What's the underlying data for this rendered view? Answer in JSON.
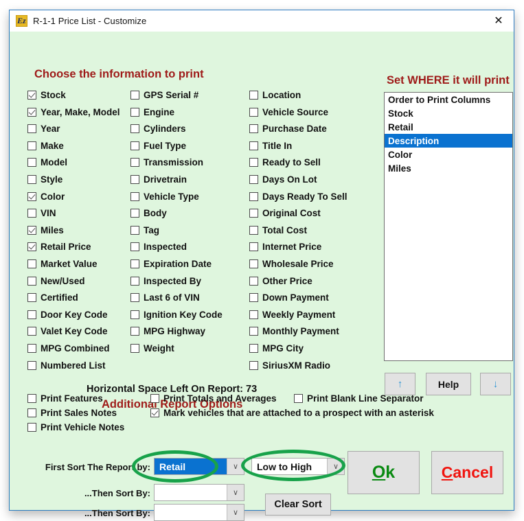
{
  "window": {
    "title": "R-1-1 Price List - Customize",
    "app_icon": "ez-logo-icon",
    "close_label": "✕",
    "background": "#dff6de",
    "border_color": "#2a7ac0"
  },
  "headings": {
    "choose": "Choose the information to print",
    "set_where": "Set WHERE it will print",
    "horizontal_space": "Horizontal Space Left On Report: 73",
    "additional_options": "Additional Report Options"
  },
  "columns": {
    "col1": [
      {
        "label": "Stock",
        "checked": true
      },
      {
        "label": "Year, Make, Model",
        "checked": true
      },
      {
        "label": "Year",
        "checked": false
      },
      {
        "label": "Make",
        "checked": false
      },
      {
        "label": "Model",
        "checked": false
      },
      {
        "label": "Style",
        "checked": false
      },
      {
        "label": "Color",
        "checked": true
      },
      {
        "label": "VIN",
        "checked": false
      },
      {
        "label": "Miles",
        "checked": true
      },
      {
        "label": "Retail Price",
        "checked": true
      },
      {
        "label": "Market Value",
        "checked": false
      },
      {
        "label": "New/Used",
        "checked": false
      },
      {
        "label": "Certified",
        "checked": false
      },
      {
        "label": "Door Key Code",
        "checked": false
      },
      {
        "label": "Valet Key Code",
        "checked": false
      },
      {
        "label": "MPG Combined",
        "checked": false
      },
      {
        "label": "Numbered List",
        "checked": false
      }
    ],
    "col2": [
      {
        "label": "GPS Serial #",
        "checked": false
      },
      {
        "label": "Engine",
        "checked": false
      },
      {
        "label": "Cylinders",
        "checked": false
      },
      {
        "label": "Fuel Type",
        "checked": false
      },
      {
        "label": "Transmission",
        "checked": false
      },
      {
        "label": "Drivetrain",
        "checked": false
      },
      {
        "label": "Vehicle Type",
        "checked": false
      },
      {
        "label": "Body",
        "checked": false
      },
      {
        "label": "Tag",
        "checked": false
      },
      {
        "label": "Inspected",
        "checked": false
      },
      {
        "label": "Expiration Date",
        "checked": false
      },
      {
        "label": "Inspected By",
        "checked": false
      },
      {
        "label": "Last 6 of VIN",
        "checked": false
      },
      {
        "label": "Ignition Key Code",
        "checked": false
      },
      {
        "label": "MPG Highway",
        "checked": false
      },
      {
        "label": "Weight",
        "checked": false
      }
    ],
    "col3": [
      {
        "label": "Location",
        "checked": false
      },
      {
        "label": "Vehicle Source",
        "checked": false
      },
      {
        "label": "Purchase Date",
        "checked": false
      },
      {
        "label": "Title In",
        "checked": false
      },
      {
        "label": "Ready to Sell",
        "checked": false
      },
      {
        "label": "Days On Lot",
        "checked": false
      },
      {
        "label": "Days Ready To Sell",
        "checked": false
      },
      {
        "label": "Original Cost",
        "checked": false
      },
      {
        "label": "Total Cost",
        "checked": false
      },
      {
        "label": "Internet Price",
        "checked": false
      },
      {
        "label": "Wholesale Price",
        "checked": false
      },
      {
        "label": "Other Price",
        "checked": false
      },
      {
        "label": "Down Payment",
        "checked": false
      },
      {
        "label": "Weekly Payment",
        "checked": false
      },
      {
        "label": "Monthly Payment",
        "checked": false
      },
      {
        "label": "MPG City",
        "checked": false
      },
      {
        "label": "SiriusXM Radio",
        "checked": false
      }
    ]
  },
  "order_list": {
    "items": [
      {
        "label": "Order to Print Columns",
        "selected": false
      },
      {
        "label": "Stock",
        "selected": false
      },
      {
        "label": "Retail",
        "selected": false
      },
      {
        "label": "Description",
        "selected": true
      },
      {
        "label": "Color",
        "selected": false
      },
      {
        "label": "Miles",
        "selected": false
      }
    ],
    "selection_color": "#0a72d0"
  },
  "side_buttons": {
    "move_up": "↑",
    "help": "Help",
    "move_down": "↓",
    "arrow_color": "#2e95d3"
  },
  "additional_options": [
    {
      "label": "Print Features",
      "checked": false
    },
    {
      "label": "Print Sales Notes",
      "checked": false
    },
    {
      "label": "Print Vehicle Notes",
      "checked": false
    },
    {
      "label": "Print Totals and Averages",
      "checked": false
    },
    {
      "label": "Mark vehicles that are attached to a prospect with an asterisk",
      "checked": true
    },
    {
      "label": "Print Blank Line Separator",
      "checked": false
    }
  ],
  "sorting": {
    "first_label": "First Sort The Report by:",
    "first_value": "Retail",
    "direction_value": "Low to High",
    "then_label_1": "...Then Sort By:",
    "then_value_1": "",
    "then_label_2": "...Then Sort By:",
    "then_value_2": "",
    "clear_sort": "Clear Sort",
    "dropdown_glyph": "∨"
  },
  "actions": {
    "ok_first": "O",
    "ok_rest": "k",
    "cancel_first": "C",
    "cancel_rest": "ancel",
    "ok_color": "#0a8a12",
    "cancel_color": "#f0140f"
  },
  "highlights": {
    "oval_color": "#18a24a"
  }
}
